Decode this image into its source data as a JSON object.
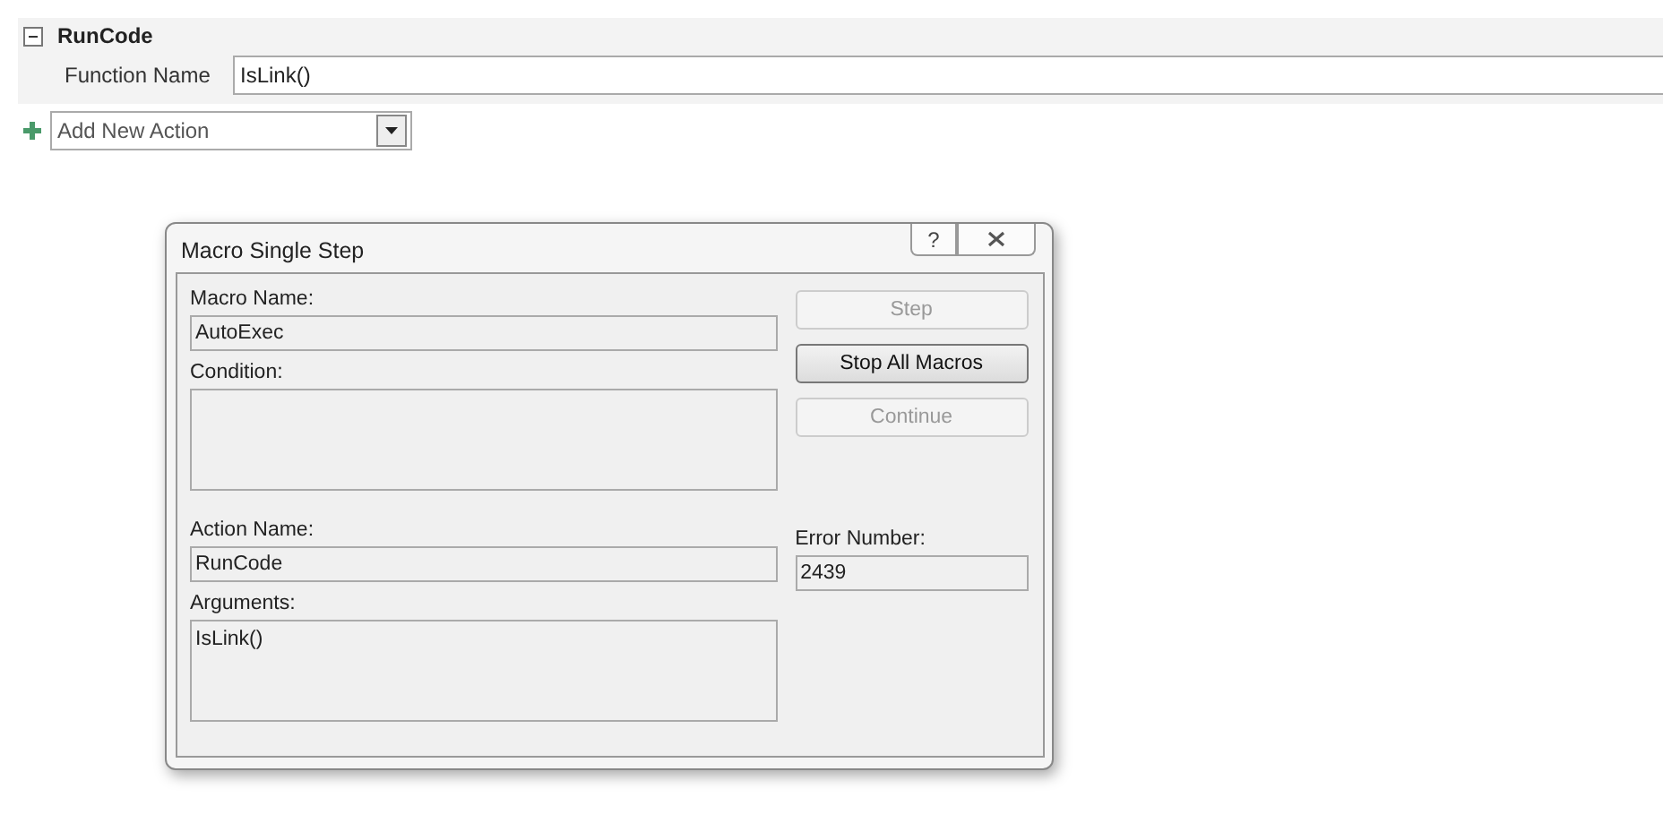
{
  "action_block": {
    "title": "RunCode",
    "expanded": true,
    "argument_label": "Function Name",
    "argument_value": "IsLink()"
  },
  "add_action": {
    "value": "Add New Action"
  },
  "dialog": {
    "title": "Macro Single Step",
    "help_glyph": "?",
    "fields": [
      {
        "label": "Macro Name:",
        "value": "AutoExec",
        "kind": "line"
      },
      {
        "label": "Condition:",
        "kind": "area"
      },
      {
        "label": "Action Name:",
        "value": "RunCode",
        "kind": "line"
      },
      {
        "label": "Arguments:",
        "value": "IsLink()",
        "kind": "area"
      }
    ],
    "error": {
      "label": "Error Number:",
      "value": "2439"
    },
    "buttons": [
      {
        "label": "Step",
        "disabled": true
      },
      {
        "label": "Stop All Macros",
        "disabled": false
      },
      {
        "label": "Continue",
        "disabled": true
      }
    ]
  }
}
